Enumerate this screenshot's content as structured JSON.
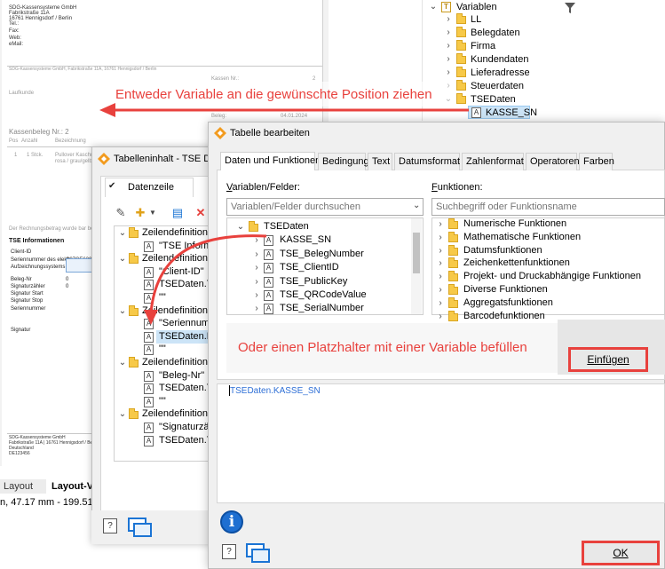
{
  "report": {
    "company": "SDG-Kassensysteme GmbH",
    "street": "Fabrikstraße 11A",
    "city": "16761 Hennigsdorf / Berlin",
    "tel": "Tel.:",
    "fax": "Fax:",
    "web": "Web:",
    "email": "eMail:",
    "sender_line": "SDG-Kassensysteme GmbH, Fabrikstraße 11A, 16761 Hennigsdorf / Berlin",
    "kassennr_label": "Kassen Nr.:",
    "kassennr_value": "2",
    "field_label": "Laufkunde",
    "beleg_label": "Beleg:",
    "date": "04.01.2024",
    "heading": "Kassenbeleg Nr.: 2",
    "col_pos": "Pos",
    "col_anzahl": "Anzahl",
    "col_bez": "Bezeichnung",
    "row1_pos": "1",
    "row1_anz": "1 Stck.",
    "row1_bez": "Pullover Kaschmir",
    "row1_bez2": "rosa / grau/gelb",
    "note": "Der Rechnungsbetrag wurde bar bezahlt.",
    "tse_heading": "TSE Informationen",
    "tse_rows": [
      {
        "label": "Client-ID",
        "value": ""
      },
      {
        "label": "Seriennummer des elektr.",
        "value": "C07CE620..."
      },
      {
        "label": "Aufzeichnungssystems",
        "value": ""
      },
      {
        "label": "Beleg-Nr",
        "value": "0"
      },
      {
        "label": "Signaturzähler",
        "value": "0"
      },
      {
        "label": "Signatur Start",
        "value": ""
      },
      {
        "label": "Signatur Stop",
        "value": ""
      },
      {
        "label": "Seriennummer",
        "value": ""
      },
      {
        "label": "",
        "value": ""
      },
      {
        "label": "Signatur",
        "value": ""
      }
    ],
    "footer": [
      "SDG-Kassensysteme GmbH",
      "Fabrikstraße 11A | 16761 Hennigsdorf / Berlin",
      "Deutschland",
      "DE123456"
    ]
  },
  "bottom_tabs": {
    "layout": "Layout",
    "layout_vo": "Layout-Vo"
  },
  "coords": "n, 47.17 mm - 199.51 mm",
  "right_tree": {
    "root": "Variablen",
    "items": [
      "LL",
      "Belegdaten",
      "Firma",
      "Kundendaten",
      "Lieferadresse",
      "Steuerdaten",
      "TSEDaten",
      "KASSE_SN"
    ]
  },
  "annotations": {
    "top": "Entweder Variable an die gewünschte Position ziehen",
    "bottom": "Oder einen Platzhalter mit einer Variable befüllen"
  },
  "dialog1": {
    "title": "Tabelleninhalt - TSE Daten",
    "tab": "Datenzeile",
    "tree": [
      "Zeilendefinition",
      "\"TSE Informationen\"",
      "Zeilendefinition",
      "\"Client-ID\"",
      "TSEDaten.TSE_ClientID",
      "\"\"",
      "Zeilendefinition",
      "\"Seriennummer\"",
      "TSEDaten.KASSE_SN",
      "\"\"",
      "Zeilendefinition",
      "\"Beleg-Nr\"",
      "TSEDaten.TSE_BelegNumber",
      "\"\"",
      "Zeilendefinition",
      "\"Signaturzähler\"",
      "TSEDaten.TSE_SignaturCounter"
    ]
  },
  "dialog2": {
    "title": "Tabelle bearbeiten",
    "tabs": [
      "Daten und Funktionen",
      "Bedingung",
      "Text",
      "Datumsformat",
      "Zahlenformat",
      "Operatoren",
      "Farben"
    ],
    "vars_label": "Variablen/Felder:",
    "funcs_label": "Funktionen:",
    "vars_placeholder": "Variablen/Felder durchsuchen",
    "funcs_placeholder": "Suchbegriff oder Funktionsname",
    "vars_items": [
      "TSEDaten",
      "KASSE_SN",
      "TSE_BelegNumber",
      "TSE_ClientID",
      "TSE_PublicKey",
      "TSE_QRCodeValue",
      "TSE_SerialNumber"
    ],
    "funcs_items": [
      "Numerische Funktionen",
      "Mathematische Funktionen",
      "Datumsfunktionen",
      "Zeichenkettenfunktionen",
      "Projekt- und Druckabhängige Funktionen",
      "Diverse Funktionen",
      "Aggregatsfunktionen",
      "Barcodefunktionen"
    ],
    "insert_label": "Einfügen",
    "formula": "TSEDaten.KASSE_SN",
    "ok_label": "OK"
  },
  "colors": {
    "accent_red": "#e8413d",
    "selection": "#cce4f7",
    "folder": "#f7c948",
    "link_blue": "#2e6fd6"
  }
}
